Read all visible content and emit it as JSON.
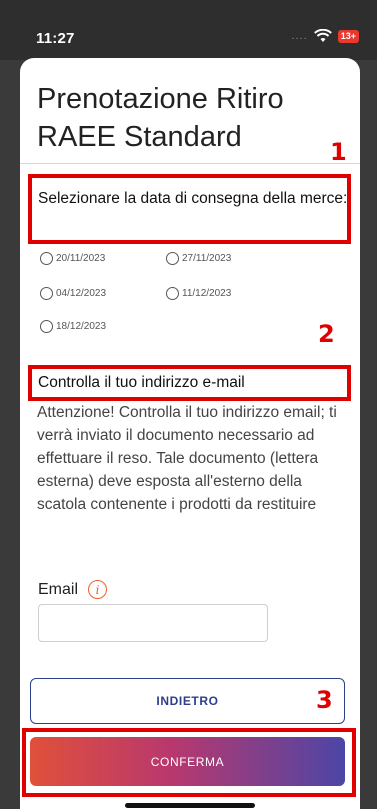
{
  "status_bar": {
    "time": "11:27",
    "signal": "....",
    "battery": "13+"
  },
  "page": {
    "title": "Prenotazione Ritiro RAEE Standard"
  },
  "annotations": {
    "marker1": "1",
    "marker2": "2",
    "marker3": "3",
    "color": "#e00000"
  },
  "delivery": {
    "heading": "Selezionare la data di consegna della merce:",
    "dates": [
      "20/11/2023",
      "27/11/2023",
      "04/12/2023",
      "11/12/2023",
      "18/12/2023"
    ]
  },
  "email_section": {
    "heading": "Controlla il tuo indirizzo e-mail",
    "body": "Attenzione! Controlla il tuo indirizzo email; ti verrà inviato il documento necessario ad effettuare il reso. Tale documento (lettera esterna) deve esposta all'esterno della scatola contenente i prodotti da restituire",
    "email_label": "Email",
    "email_value": "",
    "info_icon": "info-icon"
  },
  "buttons": {
    "back": "INDIETRO",
    "confirm": "CONFERMA"
  },
  "colors": {
    "primary": "#2c3e8c",
    "gradient_start": "#e0503a",
    "gradient_end": "#4c46a6"
  }
}
